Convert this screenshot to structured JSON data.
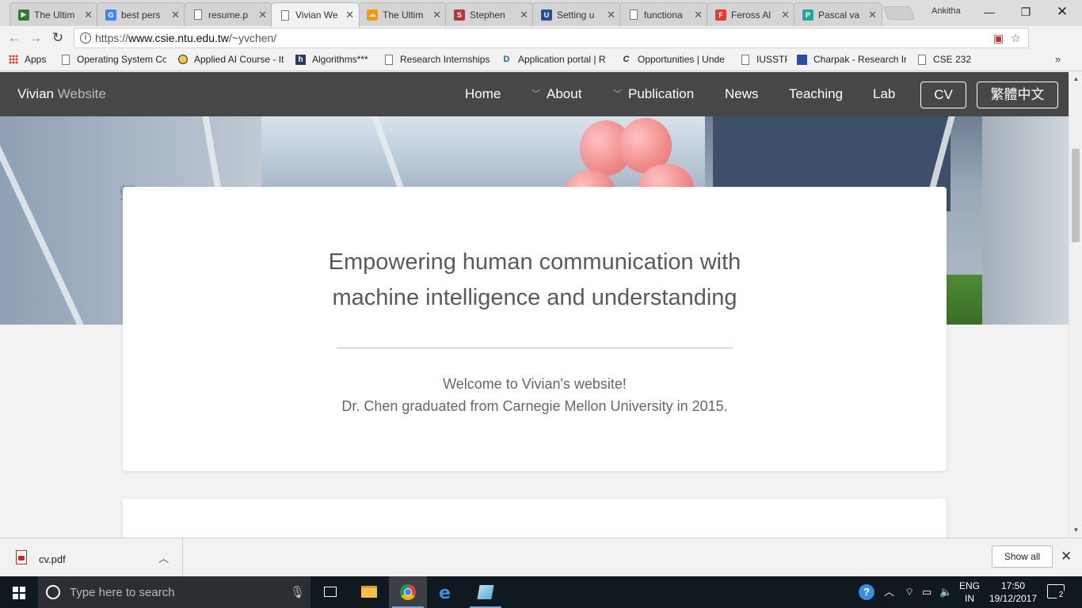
{
  "browser": {
    "tabs": [
      {
        "title": "The Ultim",
        "favicon": "video-icon",
        "color": "#2e7d32"
      },
      {
        "title": "best pers",
        "favicon": "google-icon",
        "color": "#4285f4"
      },
      {
        "title": "resume.p",
        "favicon": "document-icon",
        "color": "#777777"
      },
      {
        "title": "Vivian We",
        "favicon": "document-icon",
        "color": "#777777",
        "active": true
      },
      {
        "title": "The Ultim",
        "favicon": "cloud-icon",
        "color": "#f39c12"
      },
      {
        "title": "Stephen",
        "favicon": "scholar-icon",
        "color": "#b03a3a"
      },
      {
        "title": "Setting u",
        "favicon": "ubc-icon",
        "color": "#2c4f8c"
      },
      {
        "title": "functiona",
        "favicon": "document-icon",
        "color": "#777777"
      },
      {
        "title": "Feross Al",
        "favicon": "f-icon",
        "color": "#e53935"
      },
      {
        "title": "Pascal va",
        "favicon": "p-icon",
        "color": "#26a69a"
      }
    ],
    "profile_name": "Ankitha",
    "url_prefix": "https://",
    "url_host": "www.csie.ntu.edu.tw",
    "url_path": "/~yvchen/"
  },
  "bookmarks": [
    {
      "label": "Apps",
      "icon": "apps-grid-icon"
    },
    {
      "label": "Operating System Co",
      "icon": "document-icon"
    },
    {
      "label": "Applied AI Course - It",
      "icon": "ai-course-icon"
    },
    {
      "label": "Algorithms***",
      "icon": "h-icon"
    },
    {
      "label": "Research Internships",
      "icon": "document-icon"
    },
    {
      "label": "Application portal | R",
      "icon": "dj-icon"
    },
    {
      "label": "Opportunities | Unde",
      "icon": "cal-icon"
    },
    {
      "label": "IUSSTF",
      "icon": "document-icon"
    },
    {
      "label": "Charpak - Research Ir",
      "icon": "charpak-icon"
    },
    {
      "label": "CSE 232",
      "icon": "document-icon"
    }
  ],
  "site": {
    "brand_bold": "Vivian",
    "brand_light": " Website",
    "nav": {
      "home": "Home",
      "about": "About",
      "publication": "Publication",
      "news": "News",
      "teaching": "Teaching",
      "lab": "Lab",
      "cv": "CV",
      "lang": "繁體中文"
    },
    "hero_sign": "榮",
    "headline_line1": "Empowering human communication with",
    "headline_line2": "machine intelligence and understanding",
    "welcome": "Welcome to Vivian's website!",
    "bio": "Dr. Chen graduated from Carnegie Mellon University in 2015."
  },
  "downloads": {
    "file_name": "cv.pdf",
    "show_all": "Show all"
  },
  "taskbar": {
    "search_placeholder": "Type here to search",
    "lang_line1": "ENG",
    "lang_line2": "IN",
    "time": "17:50",
    "date": "19/12/2017",
    "notification_count": "2"
  }
}
